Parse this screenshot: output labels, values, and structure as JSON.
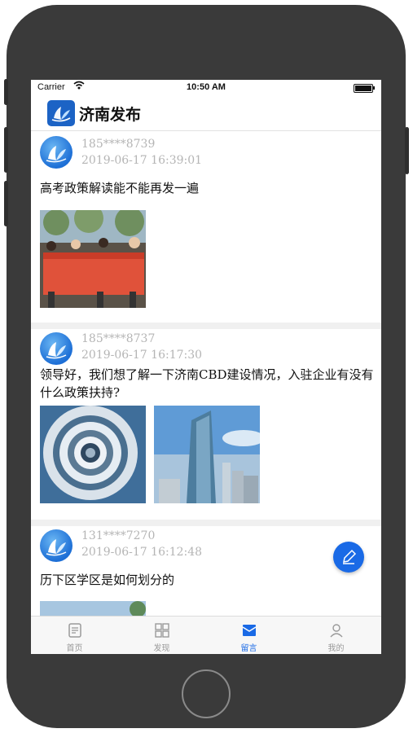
{
  "status_bar": {
    "carrier": "Carrier",
    "time": "10:50 AM"
  },
  "app": {
    "title": "济南发布"
  },
  "posts": [
    {
      "phone": "185****8739",
      "time": "2019-06-17  16:39:01",
      "text": "高考政策解读能不能再发一遍"
    },
    {
      "phone": "185****8737",
      "time": "2019-06-17  16:17:30",
      "text": "领导好，我们想了解一下济南CBD建设情况，入驻企业有没有什么政策扶持?"
    },
    {
      "phone": "131****7270",
      "time": "2019-06-17  16:12:48",
      "text": "历下区学区是如何划分的"
    }
  ],
  "tabs": [
    {
      "label": "首页",
      "icon": "home-doc-icon"
    },
    {
      "label": "发现",
      "icon": "grid-icon"
    },
    {
      "label": "留言",
      "icon": "mail-icon",
      "active": true
    },
    {
      "label": "我的",
      "icon": "person-icon"
    }
  ],
  "colors": {
    "accent": "#1a6ae6",
    "logo": "#1c63c5",
    "meta_text": "#b5b5b5"
  }
}
